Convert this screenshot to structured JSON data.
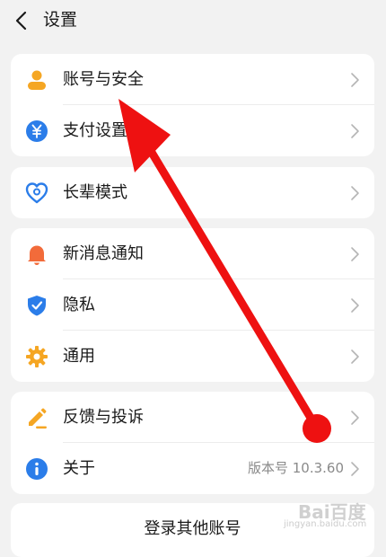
{
  "header": {
    "title": "设置"
  },
  "groups": [
    {
      "items": [
        {
          "label": "账号与安全",
          "icon": "person-icon",
          "color": "#f5a623"
        },
        {
          "label": "支付设置",
          "icon": "yuan-icon",
          "color": "#2b7de9"
        }
      ]
    },
    {
      "items": [
        {
          "label": "长辈模式",
          "icon": "heart-icon",
          "color": "#2b7de9"
        }
      ]
    },
    {
      "items": [
        {
          "label": "新消息通知",
          "icon": "bell-icon",
          "color": "#f26b3a"
        },
        {
          "label": "隐私",
          "icon": "shield-icon",
          "color": "#2b7de9"
        },
        {
          "label": "通用",
          "icon": "gear-icon",
          "color": "#f5a623"
        }
      ]
    },
    {
      "items": [
        {
          "label": "反馈与投诉",
          "icon": "pencil-icon",
          "color": "#f5a623"
        },
        {
          "label": "关于",
          "icon": "info-icon",
          "color": "#2b7de9",
          "value": "版本号 10.3.60"
        }
      ]
    }
  ],
  "footer": {
    "switch_account_label": "登录其他账号"
  },
  "watermark": {
    "text": "Bai百度",
    "sub": "jingyan.baidu.com"
  },
  "colors": {
    "annotation": "#ee1111",
    "background": "#f2f2f2"
  }
}
